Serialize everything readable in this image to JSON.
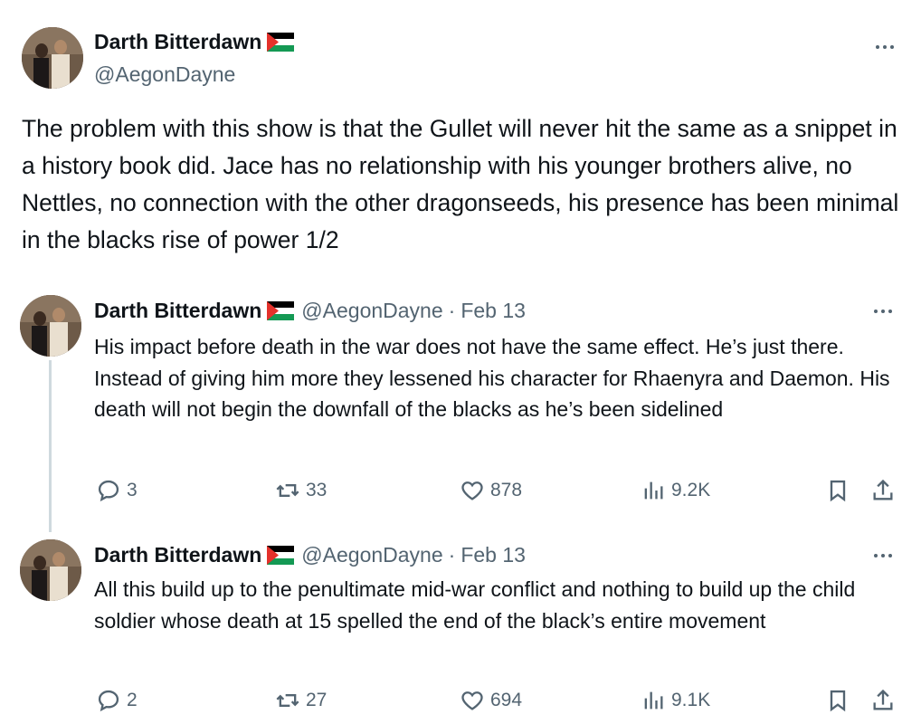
{
  "main_tweet": {
    "display_name": "Darth Bitterdawn",
    "handle": "@AegonDayne",
    "text": "The problem with this show is that the Gullet will never hit the same as a snippet in a history book did. Jace has no relationship with his younger brothers alive, no Nettles, no connection with the other dragonseeds, his presence has been minimal in the blacks rise of power 1/2"
  },
  "replies": [
    {
      "display_name": "Darth Bitterdawn",
      "handle": "@AegonDayne",
      "separator": "·",
      "date": "Feb 13",
      "text": "His impact before death in the war does not have the same effect. He’s just there. Instead of giving him more they lessened his character for Rhaenyra and Daemon. His death will not begin the downfall of the blacks as he’s been sidelined",
      "replies_count": "3",
      "reposts_count": "33",
      "likes_count": "878",
      "views_count": "9.2K"
    },
    {
      "display_name": "Darth Bitterdawn",
      "handle": "@AegonDayne",
      "separator": "·",
      "date": "Feb 13",
      "text": "All this build up to the penultimate mid-war conflict and nothing to build up the child soldier whose death at 15 spelled the end of the black’s entire movement",
      "replies_count": "2",
      "reposts_count": "27",
      "likes_count": "694",
      "views_count": "9.1K"
    }
  ],
  "icons": {
    "flag": "palestine-flag-icon",
    "more": "more-horizontal-icon",
    "reply": "reply-bubble-icon",
    "repost": "repost-icon",
    "like": "heart-icon",
    "views": "views-bar-icon",
    "bookmark": "bookmark-icon",
    "share": "share-icon"
  },
  "colors": {
    "text_primary": "#0f1419",
    "text_secondary": "#536471",
    "thread_line": "#cfd9de",
    "background": "#ffffff"
  }
}
